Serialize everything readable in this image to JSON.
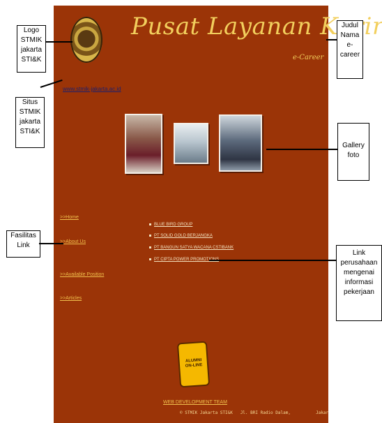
{
  "page": {
    "title": "Pusat Layanan Karir",
    "subtitle": "e-Career",
    "site_link": "www.stmik-jakarta.ac.id"
  },
  "nav": [
    ">>Home",
    ">>About Us",
    ">>Available Position",
    ">>Articles"
  ],
  "companies": [
    "BLUE BIRD GROUP",
    "PT SOLID GOLD BERJANGKA",
    "PT BANGUN SATYA WACANA CSTIBANK",
    "PT CIPTA POWER PROMOTIONS"
  ],
  "alumni_badge": "ALUMNI ON-LINE",
  "footer": {
    "title": "WEB DEVELOPMENT TEAM",
    "address": "© STMIK Jakarta STI&K   Jl. BRI Radio Dalam,          Jakar"
  },
  "annotations": {
    "logo": [
      "Logo",
      "STMIK",
      "jakarta",
      "STI&K"
    ],
    "site": [
      "Situs",
      "STMIK",
      "jakarta",
      "STI&K"
    ],
    "facilities": [
      "Fasilitas",
      "Link"
    ],
    "title": [
      "Judul",
      "Nama",
      "e-",
      "career"
    ],
    "gallery": [
      "Gallery",
      "foto"
    ],
    "company_links": [
      "Link",
      "perusahaan",
      "mengenai",
      "informasi",
      "pekerjaan"
    ]
  },
  "colors": {
    "page_bg": "#9b3407",
    "accent": "#f0c04d"
  }
}
